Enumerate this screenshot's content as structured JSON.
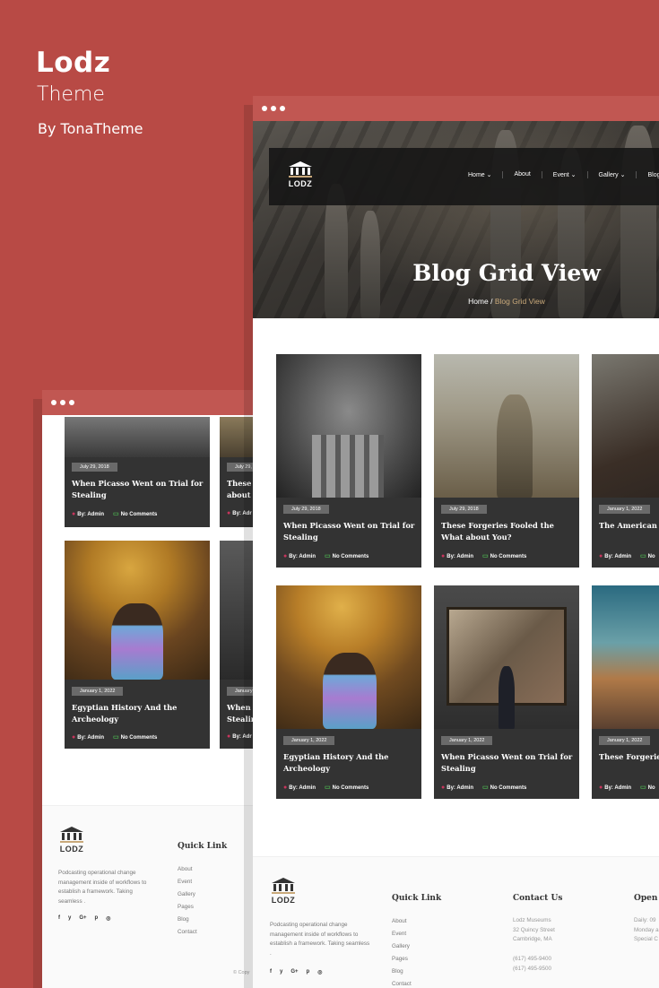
{
  "brand": {
    "title": "Lodz",
    "subtitle": "Theme",
    "by": "By TonaTheme"
  },
  "nav": {
    "logo": "LODZ",
    "items": [
      "Home ⌄",
      "About",
      "Event ⌄",
      "Gallery ⌄",
      "Blog ⌄"
    ]
  },
  "hero": {
    "title": "Blog Grid View",
    "crumb_home": "Home",
    "crumb_sep": " / ",
    "crumb_current": "Blog Grid View"
  },
  "posts": [
    {
      "date": "July 29, 2018",
      "title": "When Picasso Went on Trial for Stealing",
      "author": "By: Admin",
      "comments": "No Comments"
    },
    {
      "date": "July 29, 2018",
      "title": "These Forgeries Fooled the What about You?",
      "author": "By: Admin",
      "comments": "No Comments"
    },
    {
      "date": "January 1, 2022",
      "title": "The American B Canvas",
      "author": "By: Admin",
      "comments": "No"
    },
    {
      "date": "January 1, 2022",
      "title": "Egyptian History And the Archeology",
      "author": "By: Admin",
      "comments": "No Comments"
    },
    {
      "date": "January 1, 2022",
      "title": "When Picasso Went on Trial for Stealing",
      "author": "By: Admin",
      "comments": "No Comments"
    },
    {
      "date": "January 1, 2022",
      "title": "These Forgeries about You?",
      "author": "By: Admin",
      "comments": "No"
    }
  ],
  "back_posts": [
    {
      "date": "July 29, 2018",
      "title": "When Picasso Went on Trial for Stealing",
      "author": "By: Admin",
      "comments": "No Comments"
    },
    {
      "date": "July 29, 2",
      "title": "These I about Y",
      "author": "By: Adr"
    },
    {
      "date": "January 1, 2022",
      "title": "Egyptian History And the Archeology",
      "author": "By: Admin",
      "comments": "No Comments"
    },
    {
      "date": "January",
      "title": "When I Stealin",
      "author": "By: Adr"
    }
  ],
  "footer": {
    "logo": "LODZ",
    "desc": "Podcasting operational change management inside of workflows to establish a framework. Taking seamless .",
    "social": [
      "f",
      "y",
      "G+",
      "p",
      "◎"
    ],
    "quick_title": "Quick Link",
    "quick_links": [
      "About",
      "Event",
      "Gallery",
      "Pages",
      "Blog",
      "Contact"
    ],
    "contact_title": "Contact Us",
    "address": [
      "Lodz Museums",
      "32 Quincy Street",
      "Cambridge, MA"
    ],
    "phones": [
      "(617) 495-9400",
      "(617) 495-9500"
    ],
    "open_title": "Open I",
    "open_lines": [
      "Daily: 09",
      "Monday a",
      "Special C"
    ],
    "copyright": "© Copy"
  },
  "colors": {
    "background": "#b84a45",
    "card": "#333333",
    "accent": "#c9a97a"
  }
}
